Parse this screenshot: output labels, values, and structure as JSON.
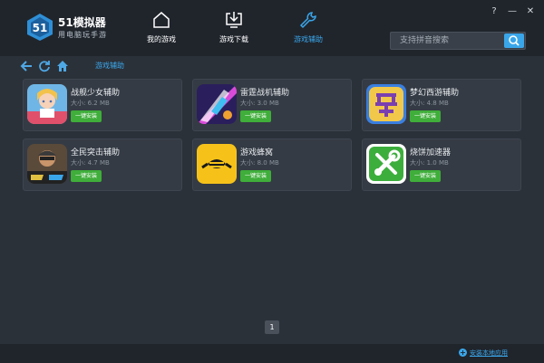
{
  "app": {
    "title": "51模拟器",
    "subtitle": "用电脑玩手游"
  },
  "nav": [
    {
      "label": "我的游戏",
      "icon": "home-icon",
      "active": false
    },
    {
      "label": "游戏下载",
      "icon": "download-icon",
      "active": false
    },
    {
      "label": "游戏辅助",
      "icon": "wrench-icon",
      "active": true
    }
  ],
  "window": {
    "help": "?",
    "minimize": "—",
    "close": "✕"
  },
  "search": {
    "placeholder": "支持拼音搜索",
    "value": ""
  },
  "breadcrumb": "游戏辅助",
  "cards": [
    {
      "name": "战舰少女辅助",
      "size": "大小: 6.2 MB",
      "button": "一键安装",
      "icon": "anime-girl-game-icon"
    },
    {
      "name": "雷霆战机辅助",
      "size": "大小: 3.0 MB",
      "button": "一键安装",
      "icon": "fighter-jet-game-icon"
    },
    {
      "name": "梦幻西游辅助",
      "size": "大小: 4.8 MB",
      "button": "一键安装",
      "icon": "dream-glyph-game-icon"
    },
    {
      "name": "全民突击辅助",
      "size": "大小: 4.7 MB",
      "button": "一键安装",
      "icon": "soldier-game-icon"
    },
    {
      "name": "游戏蜂窝",
      "size": "大小: 8.0 MB",
      "button": "一键安装",
      "icon": "bee-app-icon"
    },
    {
      "name": "烧饼加速器",
      "size": "大小: 1.0 MB",
      "button": "一键安装",
      "icon": "tools-app-icon"
    }
  ],
  "pagination": {
    "current": "1"
  },
  "footer": {
    "link": "安装本地应用"
  }
}
